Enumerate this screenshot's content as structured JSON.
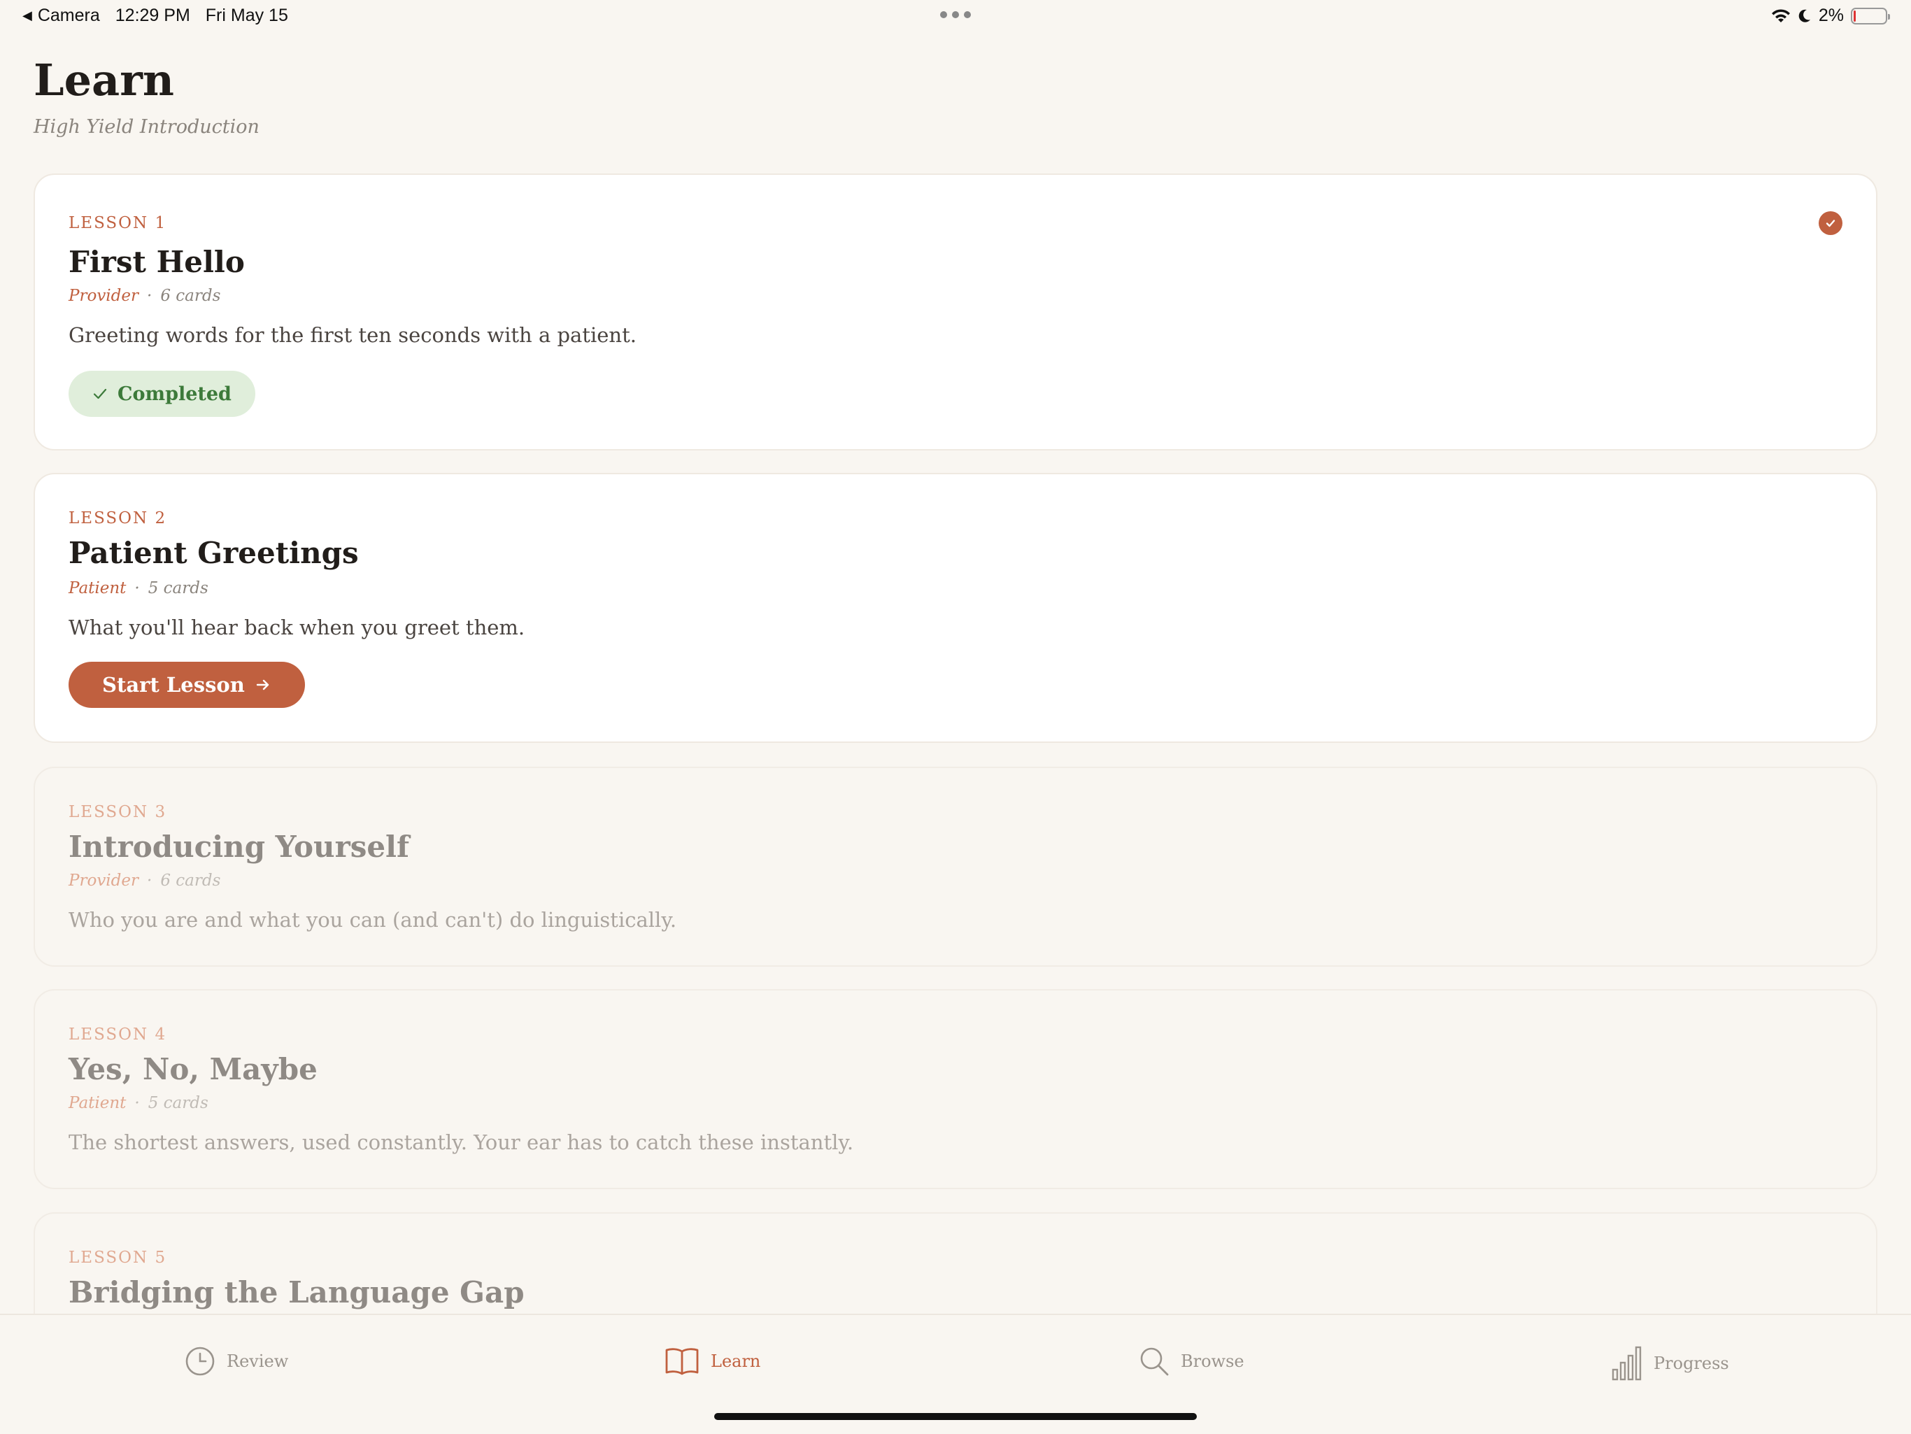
{
  "status_bar": {
    "back_label": "Camera",
    "time": "12:29 PM",
    "date": "Fri May 15",
    "battery": "2%",
    "battery_level": 0.02
  },
  "header": {
    "title": "Learn",
    "subtitle": "High Yield Introduction"
  },
  "lessons": [
    {
      "label": "LESSON 1",
      "title": "First Hello",
      "role": "Provider",
      "cards": "6 cards",
      "description": "Greeting words for the first ten seconds with a patient.",
      "status": "completed",
      "action_label": "Completed"
    },
    {
      "label": "LESSON 2",
      "title": "Patient Greetings",
      "role": "Patient",
      "cards": "5 cards",
      "description": "What you'll hear back when you greet them.",
      "status": "available",
      "action_label": "Start Lesson"
    },
    {
      "label": "LESSON 3",
      "title": "Introducing Yourself",
      "role": "Provider",
      "cards": "6 cards",
      "description": "Who you are and what you can (and can't) do linguistically.",
      "status": "locked"
    },
    {
      "label": "LESSON 4",
      "title": "Yes, No, Maybe",
      "role": "Patient",
      "cards": "5 cards",
      "description": "The shortest answers, used constantly. Your ear has to catch these instantly.",
      "status": "locked"
    },
    {
      "label": "LESSON 5",
      "title": "Bridging the Language Gap",
      "status": "locked"
    }
  ],
  "tab_bar": {
    "tabs": [
      {
        "label": "Review",
        "icon": "clock-icon"
      },
      {
        "label": "Learn",
        "icon": "book-icon",
        "active": true
      },
      {
        "label": "Browse",
        "icon": "search-icon"
      },
      {
        "label": "Progress",
        "icon": "bar-chart-icon"
      }
    ]
  },
  "colors": {
    "accent": "#c0603f",
    "background": "#f9f6f1",
    "success_bg": "#e0eedb",
    "success_text": "#3c7a3a"
  }
}
